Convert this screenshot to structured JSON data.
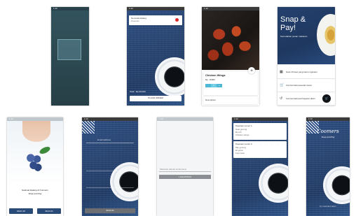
{
  "status": {
    "time": "1:12"
  },
  "scan": {
    "status_time": "1:12"
  },
  "checkout": {
    "card_line1": "Se lamat datang",
    "card_line2": "Pesanan",
    "total": "Total : Rp.30.000",
    "button": "PLACE ORDER"
  },
  "product": {
    "name": "Chicken Wings",
    "price": "Rp. 15000",
    "qty_minus": "-",
    "qty_value": "1",
    "qty_plus": "+",
    "description_label": "Description"
  },
  "home": {
    "brand": "Snap & Pay!",
    "tagline": "Kemudahan pesan makanan",
    "menu": [
      {
        "icon": "qr-icon",
        "glyph": "▦",
        "label": "Scan Produk yang kamu inginkan"
      },
      {
        "icon": "cart-icon",
        "glyph": "🛒",
        "label": "Cek kembali pesanan kamu"
      },
      {
        "icon": "history-icon",
        "glyph": "↺",
        "label": "Cek kembali pembayaran disini"
      }
    ]
  },
  "welcome": {
    "caption_line1": "Selamat Datang di Coomers",
    "caption_line2": "Snap and Pay",
    "btn_left": "SIGN UP",
    "btn_right": "SIGN IN"
  },
  "login": {
    "field_label": "Email address",
    "button": "SIGN IN"
  },
  "form": {
    "field_label": "Masukan alamat email kamu",
    "button": "LANJUTKAN"
  },
  "orders": {
    "card1": [
      "Pesanan nomor 1",
      "Nasi goreng",
      "Es teh",
      "Chicken wings"
    ],
    "card2": [
      "Pesanan nomor 2",
      "Mie goreng",
      "Es jeruk",
      "Kopi susu"
    ]
  },
  "splash": {
    "logo": "Coomers",
    "subtitle": "Snap and Pay",
    "footer": "by coomers team"
  }
}
